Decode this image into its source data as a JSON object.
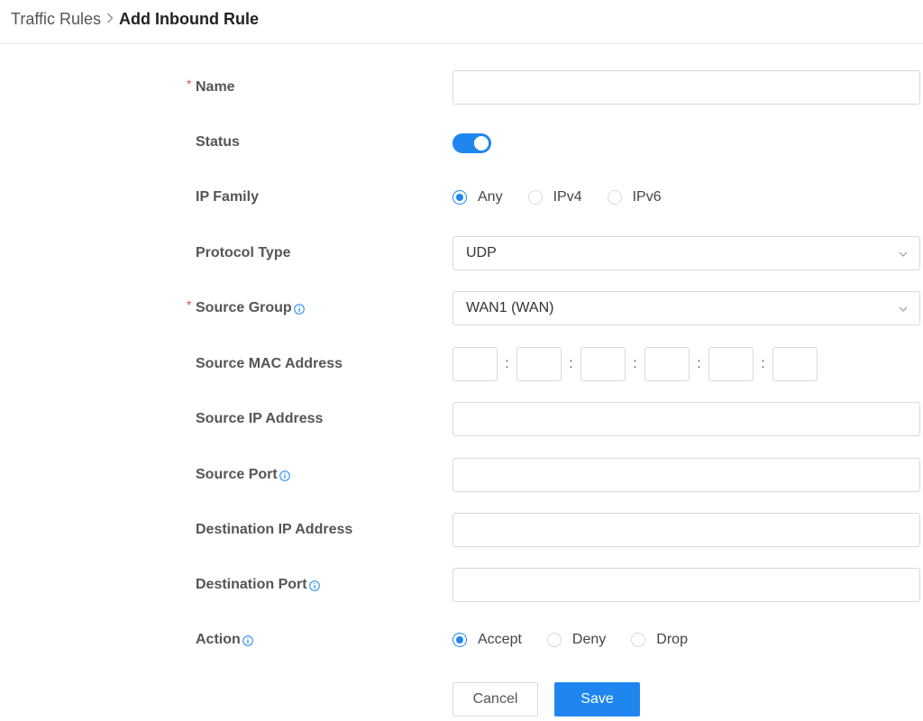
{
  "breadcrumb": {
    "parent": "Traffic Rules",
    "current": "Add Inbound Rule"
  },
  "form": {
    "name": {
      "label": "Name",
      "required": true,
      "value": ""
    },
    "status": {
      "label": "Status",
      "enabled": true
    },
    "ip_family": {
      "label": "IP Family",
      "options": [
        "Any",
        "IPv4",
        "IPv6"
      ],
      "selected": "Any"
    },
    "protocol_type": {
      "label": "Protocol Type",
      "value": "UDP"
    },
    "source_group": {
      "label": "Source Group",
      "required": true,
      "value": "WAN1 (WAN)"
    },
    "source_mac": {
      "label": "Source MAC Address",
      "separator": ":",
      "segments": [
        "",
        "",
        "",
        "",
        "",
        ""
      ]
    },
    "source_ip": {
      "label": "Source IP Address",
      "value": ""
    },
    "source_port": {
      "label": "Source Port",
      "value": ""
    },
    "destination_ip": {
      "label": "Destination IP Address",
      "value": ""
    },
    "destination_port": {
      "label": "Destination Port",
      "value": ""
    },
    "action": {
      "label": "Action",
      "options": [
        "Accept",
        "Deny",
        "Drop"
      ],
      "selected": "Accept"
    }
  },
  "buttons": {
    "cancel": "Cancel",
    "save": "Save"
  },
  "icons": {
    "info": "info-circle-icon",
    "chevron": "chevron-down-icon",
    "breadcrumb_separator": "chevron-right-icon"
  },
  "colors": {
    "accent": "#1f86f0",
    "required": "#e34d4d",
    "border": "#d9d9d9",
    "label": "#555555"
  }
}
